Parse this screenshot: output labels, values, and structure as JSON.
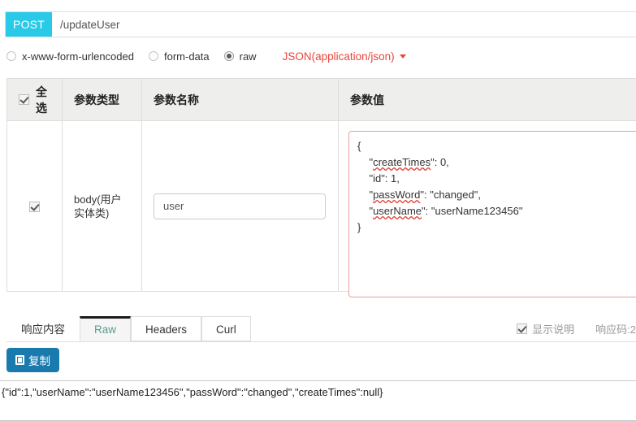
{
  "request": {
    "method": "POST",
    "url_value": "/updateUser",
    "url_placeholder": "/updateUser",
    "method_color": "#29c9e8"
  },
  "body_types": {
    "options": [
      {
        "label": "x-www-form-urlencoded",
        "checked": false
      },
      {
        "label": "form-data",
        "checked": false
      },
      {
        "label": "raw",
        "checked": true
      }
    ],
    "content_type_label": "JSON(application/json)",
    "content_type_color": "#e8453c"
  },
  "params_table": {
    "headers": {
      "select_all": "全选",
      "param_type": "参数类型",
      "param_name": "参数名称",
      "param_value": "参数值"
    },
    "select_all_checked": true,
    "rows": [
      {
        "checked": true,
        "type": "body(用户实体类)",
        "name_value": "user",
        "name_placeholder": "user",
        "value_json": {
          "open_brace": "{",
          "lines": [
            {
              "indent": "    ",
              "key": "createTimes",
              "misspelled": true,
              "sep": "\": ",
              "val": "0,"
            },
            {
              "indent": "    ",
              "key": "id",
              "misspelled": false,
              "sep": "\": ",
              "val": "1,"
            },
            {
              "indent": "    ",
              "key": "passWord",
              "misspelled": true,
              "sep": "\": ",
              "val": "\"changed\","
            },
            {
              "indent": "    ",
              "key": "userName",
              "misspelled": true,
              "sep": "\": ",
              "val": "\"userName123456\""
            }
          ],
          "close_brace": "}"
        }
      }
    ]
  },
  "response": {
    "tabs": [
      {
        "label": "响应内容",
        "active": false,
        "plain": true
      },
      {
        "label": "Raw",
        "active": true,
        "plain": false
      },
      {
        "label": "Headers",
        "active": false,
        "plain": false
      },
      {
        "label": "Curl",
        "active": false,
        "plain": false
      }
    ],
    "show_description_label": "显示说明",
    "show_description_checked": true,
    "response_code_label": "响应码:2",
    "copy_button_label": "复制",
    "result_text": "{\"id\":1,\"userName\":\"userName123456\",\"passWord\":\"changed\",\"createTimes\":null}"
  }
}
